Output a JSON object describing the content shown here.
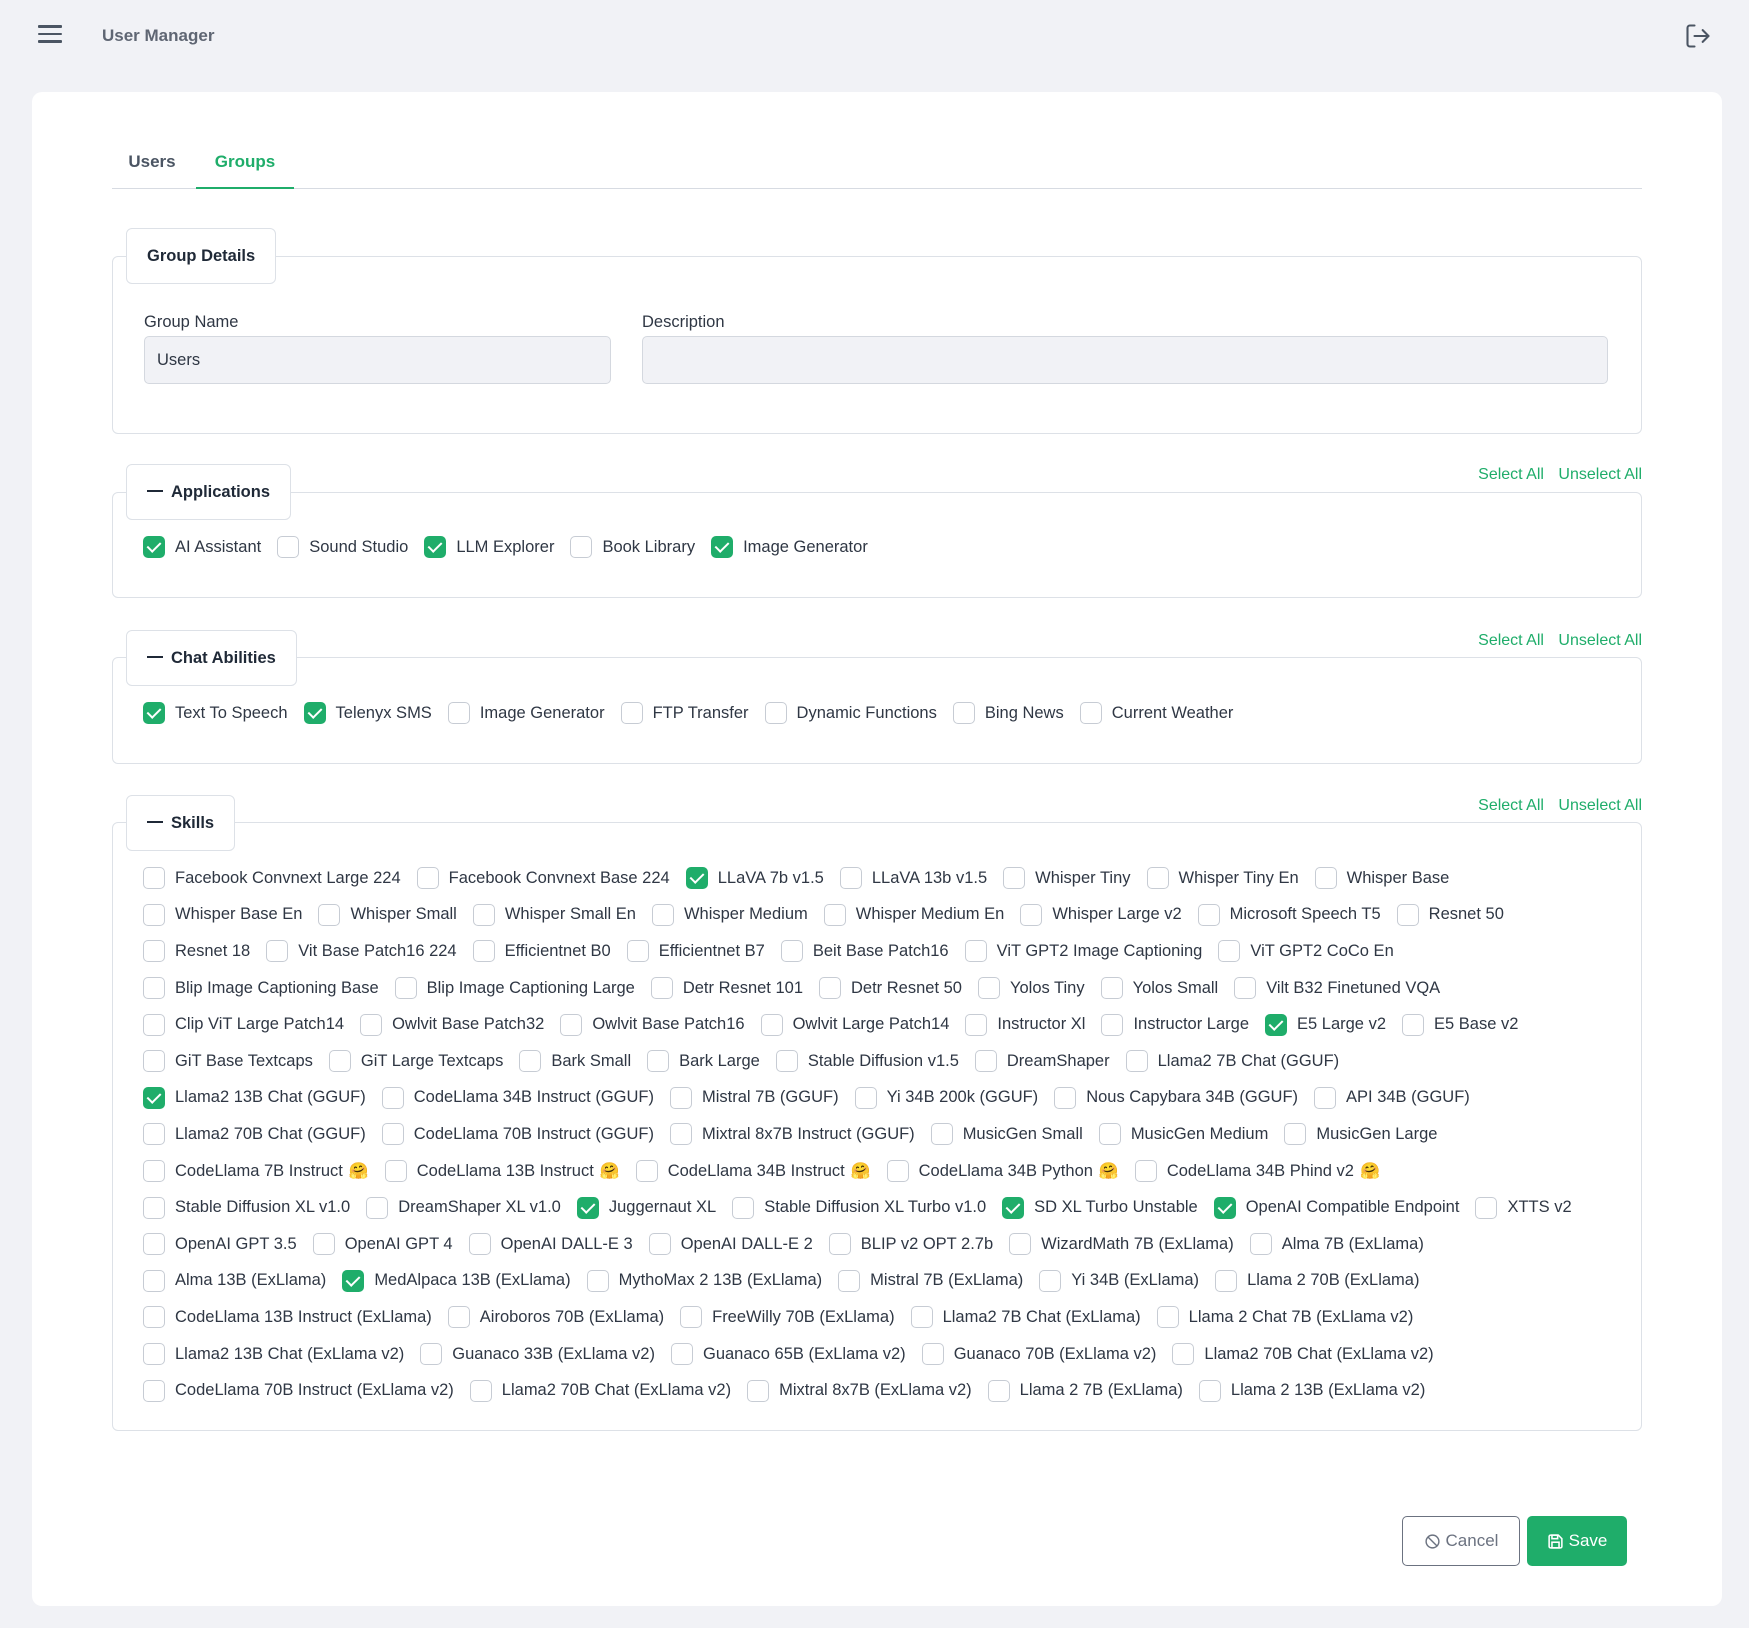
{
  "header": {
    "title": "User Manager"
  },
  "tabs": [
    {
      "label": "Users",
      "active": false
    },
    {
      "label": "Groups",
      "active": true
    }
  ],
  "group_details": {
    "legend": "Group Details",
    "group_name_label": "Group Name",
    "group_name_value": "Users",
    "description_label": "Description",
    "description_value": ""
  },
  "select_all_label": "Select All",
  "unselect_all_label": "Unselect All",
  "applications": {
    "legend": "Applications",
    "rows": [
      [
        {
          "label": "AI Assistant",
          "checked": true
        },
        {
          "label": "Sound Studio",
          "checked": false
        },
        {
          "label": "LLM Explorer",
          "checked": true
        },
        {
          "label": "Book Library",
          "checked": false
        },
        {
          "label": "Image Generator",
          "checked": true
        }
      ]
    ]
  },
  "chat_abilities": {
    "legend": "Chat Abilities",
    "rows": [
      [
        {
          "label": "Text To Speech",
          "checked": true
        },
        {
          "label": "Telenyx SMS",
          "checked": true
        },
        {
          "label": "Image Generator",
          "checked": false
        },
        {
          "label": "FTP Transfer",
          "checked": false
        },
        {
          "label": "Dynamic Functions",
          "checked": false
        },
        {
          "label": "Bing News",
          "checked": false
        },
        {
          "label": "Current Weather",
          "checked": false
        }
      ]
    ]
  },
  "skills": {
    "legend": "Skills",
    "rows": [
      [
        {
          "label": "Facebook Convnext Large 224",
          "checked": false
        },
        {
          "label": "Facebook Convnext Base 224",
          "checked": false
        },
        {
          "label": "LLaVA 7b v1.5",
          "checked": true
        },
        {
          "label": "LLaVA 13b v1.5",
          "checked": false
        },
        {
          "label": "Whisper Tiny",
          "checked": false
        },
        {
          "label": "Whisper Tiny En",
          "checked": false
        },
        {
          "label": "Whisper Base",
          "checked": false
        }
      ],
      [
        {
          "label": "Whisper Base En",
          "checked": false
        },
        {
          "label": "Whisper Small",
          "checked": false
        },
        {
          "label": "Whisper Small En",
          "checked": false
        },
        {
          "label": "Whisper Medium",
          "checked": false
        },
        {
          "label": "Whisper Medium En",
          "checked": false
        },
        {
          "label": "Whisper Large v2",
          "checked": false
        },
        {
          "label": "Microsoft Speech T5",
          "checked": false
        },
        {
          "label": "Resnet 50",
          "checked": false
        }
      ],
      [
        {
          "label": "Resnet 18",
          "checked": false
        },
        {
          "label": "Vit Base Patch16 224",
          "checked": false
        },
        {
          "label": "Efficientnet B0",
          "checked": false
        },
        {
          "label": "Efficientnet B7",
          "checked": false
        },
        {
          "label": "Beit Base Patch16",
          "checked": false
        },
        {
          "label": "ViT GPT2 Image Captioning",
          "checked": false
        },
        {
          "label": "ViT GPT2 CoCo En",
          "checked": false
        }
      ],
      [
        {
          "label": "Blip Image Captioning Base",
          "checked": false
        },
        {
          "label": "Blip Image Captioning Large",
          "checked": false
        },
        {
          "label": "Detr Resnet 101",
          "checked": false
        },
        {
          "label": "Detr Resnet 50",
          "checked": false
        },
        {
          "label": "Yolos Tiny",
          "checked": false
        },
        {
          "label": "Yolos Small",
          "checked": false
        },
        {
          "label": "Vilt B32 Finetuned VQA",
          "checked": false
        }
      ],
      [
        {
          "label": "Clip ViT Large Patch14",
          "checked": false
        },
        {
          "label": "Owlvit Base Patch32",
          "checked": false
        },
        {
          "label": "Owlvit Base Patch16",
          "checked": false
        },
        {
          "label": "Owlvit Large Patch14",
          "checked": false
        },
        {
          "label": "Instructor Xl",
          "checked": false
        },
        {
          "label": "Instructor Large",
          "checked": false
        },
        {
          "label": "E5 Large v2",
          "checked": true
        },
        {
          "label": "E5 Base v2",
          "checked": false
        }
      ],
      [
        {
          "label": "GiT Base Textcaps",
          "checked": false
        },
        {
          "label": "GiT Large Textcaps",
          "checked": false
        },
        {
          "label": "Bark Small",
          "checked": false
        },
        {
          "label": "Bark Large",
          "checked": false
        },
        {
          "label": "Stable Diffusion v1.5",
          "checked": false
        },
        {
          "label": "DreamShaper",
          "checked": false
        },
        {
          "label": "Llama2 7B Chat (GGUF)",
          "checked": false
        }
      ],
      [
        {
          "label": "Llama2 13B Chat (GGUF)",
          "checked": true
        },
        {
          "label": "CodeLlama 34B Instruct (GGUF)",
          "checked": false
        },
        {
          "label": "Mistral 7B (GGUF)",
          "checked": false
        },
        {
          "label": "Yi 34B 200k (GGUF)",
          "checked": false
        },
        {
          "label": "Nous Capybara 34B (GGUF)",
          "checked": false
        },
        {
          "label": "API 34B (GGUF)",
          "checked": false
        }
      ],
      [
        {
          "label": "Llama2 70B Chat (GGUF)",
          "checked": false
        },
        {
          "label": "CodeLlama 70B Instruct (GGUF)",
          "checked": false
        },
        {
          "label": "Mixtral 8x7B Instruct (GGUF)",
          "checked": false
        },
        {
          "label": "MusicGen Small",
          "checked": false
        },
        {
          "label": "MusicGen Medium",
          "checked": false
        },
        {
          "label": "MusicGen Large",
          "checked": false
        }
      ],
      [
        {
          "label": "CodeLlama 7B Instruct",
          "checked": false,
          "emoji": "🤗"
        },
        {
          "label": "CodeLlama 13B Instruct",
          "checked": false,
          "emoji": "🤗"
        },
        {
          "label": "CodeLlama 34B Instruct",
          "checked": false,
          "emoji": "🤗"
        },
        {
          "label": "CodeLlama 34B Python",
          "checked": false,
          "emoji": "🤗"
        },
        {
          "label": "CodeLlama 34B Phind v2",
          "checked": false,
          "emoji": "🤗"
        }
      ],
      [
        {
          "label": "Stable Diffusion XL v1.0",
          "checked": false
        },
        {
          "label": "DreamShaper XL v1.0",
          "checked": false
        },
        {
          "label": "Juggernaut XL",
          "checked": true
        },
        {
          "label": "Stable Diffusion XL Turbo v1.0",
          "checked": false
        },
        {
          "label": "SD XL Turbo Unstable",
          "checked": true
        },
        {
          "label": "OpenAI Compatible Endpoint",
          "checked": true
        },
        {
          "label": "XTTS v2",
          "checked": false
        }
      ],
      [
        {
          "label": "OpenAI GPT 3.5",
          "checked": false
        },
        {
          "label": "OpenAI GPT 4",
          "checked": false
        },
        {
          "label": "OpenAI DALL-E 3",
          "checked": false
        },
        {
          "label": "OpenAI DALL-E 2",
          "checked": false
        },
        {
          "label": "BLIP v2 OPT 2.7b",
          "checked": false
        },
        {
          "label": "WizardMath 7B (ExLlama)",
          "checked": false
        },
        {
          "label": "Alma 7B (ExLlama)",
          "checked": false
        }
      ],
      [
        {
          "label": "Alma 13B (ExLlama)",
          "checked": false
        },
        {
          "label": "MedAlpaca 13B (ExLlama)",
          "checked": true
        },
        {
          "label": "MythoMax 2 13B (ExLlama)",
          "checked": false
        },
        {
          "label": "Mistral 7B (ExLlama)",
          "checked": false
        },
        {
          "label": "Yi 34B (ExLlama)",
          "checked": false
        },
        {
          "label": "Llama 2 70B (ExLlama)",
          "checked": false
        }
      ],
      [
        {
          "label": "CodeLlama 13B Instruct (ExLlama)",
          "checked": false
        },
        {
          "label": "Airoboros 70B (ExLlama)",
          "checked": false
        },
        {
          "label": "FreeWilly 70B (ExLlama)",
          "checked": false
        },
        {
          "label": "Llama2 7B Chat (ExLlama)",
          "checked": false
        },
        {
          "label": "Llama 2 Chat 7B (ExLlama v2)",
          "checked": false
        }
      ],
      [
        {
          "label": "Llama2 13B Chat (ExLlama v2)",
          "checked": false
        },
        {
          "label": "Guanaco 33B (ExLlama v2)",
          "checked": false
        },
        {
          "label": "Guanaco 65B (ExLlama v2)",
          "checked": false
        },
        {
          "label": "Guanaco 70B (ExLlama v2)",
          "checked": false
        },
        {
          "label": "Llama2 70B Chat (ExLlama v2)",
          "checked": false
        }
      ],
      [
        {
          "label": "CodeLlama 70B Instruct (ExLlama v2)",
          "checked": false
        },
        {
          "label": "Llama2 70B Chat (ExLlama v2)",
          "checked": false
        },
        {
          "label": "Mixtral 8x7B (ExLlama v2)",
          "checked": false
        },
        {
          "label": "Llama 2 7B (ExLlama)",
          "checked": false
        },
        {
          "label": "Llama 2 13B (ExLlama v2)",
          "checked": false
        }
      ]
    ]
  },
  "buttons": {
    "cancel": "Cancel",
    "save": "Save"
  },
  "colors": {
    "accent": "#1fad6a",
    "background": "#f1f2f6"
  }
}
